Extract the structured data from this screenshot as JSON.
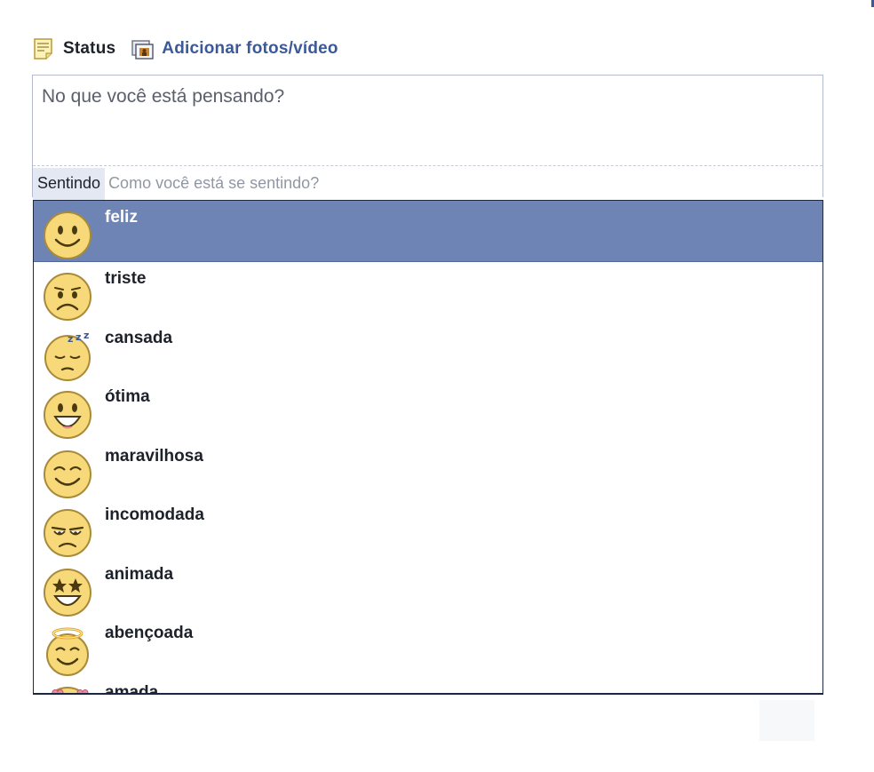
{
  "tabs": {
    "status_label": "Status",
    "photo_label": "Adicionar fotos/vídeo"
  },
  "composer": {
    "placeholder": "No que você está pensando?"
  },
  "feeling": {
    "tag_label": "Sentindo",
    "input_placeholder": "Como você está se sentindo?"
  },
  "feelings": [
    {
      "label": "feliz",
      "icon": "smile-icon",
      "selected": true
    },
    {
      "label": "triste",
      "icon": "sad-icon"
    },
    {
      "label": "cansada",
      "icon": "sleepy-icon"
    },
    {
      "label": "ótima",
      "icon": "grin-icon"
    },
    {
      "label": "maravilhosa",
      "icon": "happy-closed-eyes-icon"
    },
    {
      "label": "incomodada",
      "icon": "annoyed-icon"
    },
    {
      "label": "animada",
      "icon": "star-eyes-icon"
    },
    {
      "label": "abençoada",
      "icon": "halo-icon"
    },
    {
      "label": "amada",
      "icon": "heart-eyes-icon"
    }
  ],
  "colors": {
    "accent": "#3b5998",
    "selection": "#6d84b4",
    "emoji_fill": "#f8d979",
    "emoji_stroke": "#a88a3a"
  }
}
